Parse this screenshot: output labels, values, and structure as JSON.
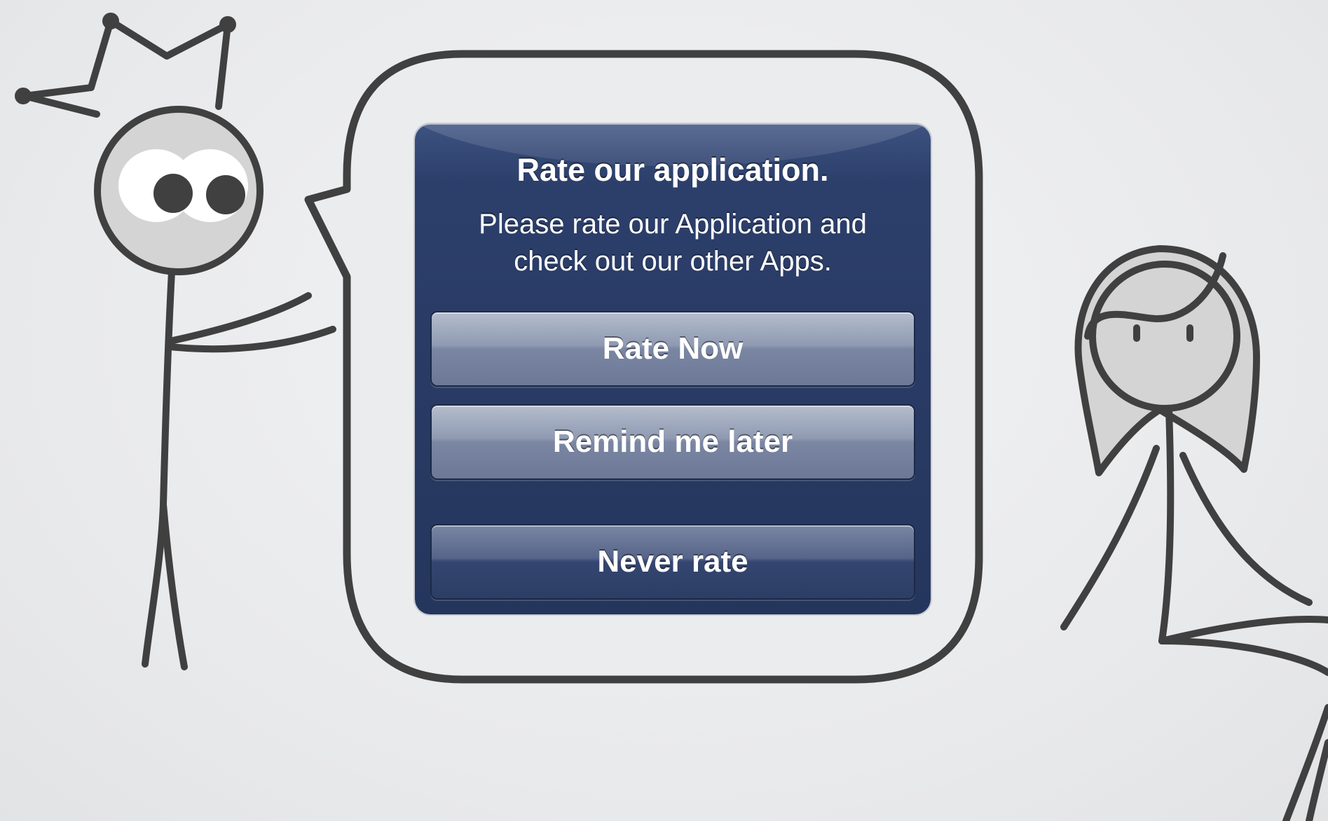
{
  "alert": {
    "title": "Rate our application.",
    "message_line1": "Please rate our Application and",
    "message_line2": "check out our other Apps.",
    "buttons": {
      "rate_now": "Rate Now",
      "remind_later": "Remind me later",
      "never_rate": "Never rate"
    }
  },
  "colors": {
    "background": "#ebecee",
    "outline": "#404040",
    "character_fill": "#d4d4d4",
    "alert_blue": "#2a3c66"
  },
  "icons": {
    "king": "king-stick-figure-illustration",
    "girl": "girl-stick-figure-illustration",
    "bubble": "speech-bubble-illustration"
  }
}
